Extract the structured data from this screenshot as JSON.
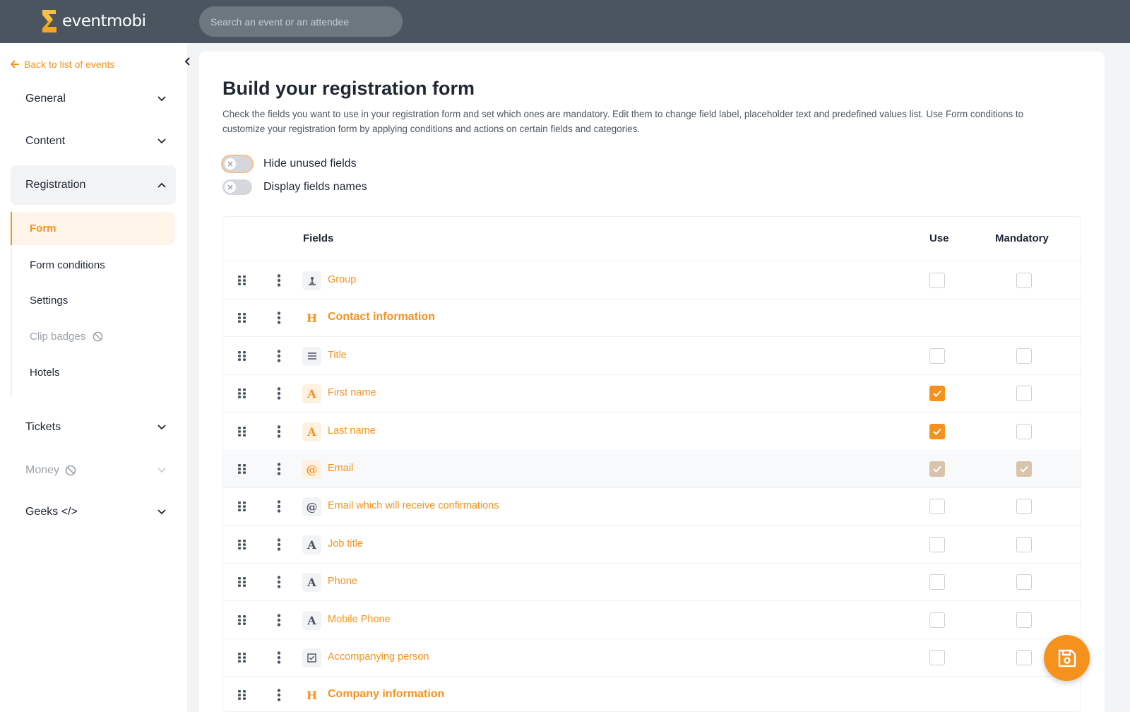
{
  "app": {
    "brand": "eventmobi",
    "brand_color": "#f5921e",
    "search_placeholder": "Search an event or an attendee"
  },
  "sidebar": {
    "back_label": "Back to list of events",
    "sections": [
      {
        "label": "General",
        "state": "collapsed"
      },
      {
        "label": "Content",
        "state": "collapsed"
      },
      {
        "label": "Registration",
        "state": "expanded"
      },
      {
        "label": "Tickets",
        "state": "collapsed"
      },
      {
        "label": "Money",
        "state": "disabled"
      },
      {
        "label": "Geeks </>",
        "state": "collapsed"
      }
    ],
    "registration_items": [
      {
        "label": "Form",
        "active": true
      },
      {
        "label": "Form conditions"
      },
      {
        "label": "Settings"
      },
      {
        "label": "Clip badges",
        "disabled": true
      },
      {
        "label": "Hotels"
      }
    ]
  },
  "main": {
    "title": "Build your registration form",
    "description_line1": "Check the fields you want to use in your registration form and set which ones are mandatory. Edit them to change field label, placeholder text and predefined values list. Use Form conditions to",
    "description_line2": "customize your registration form by applying conditions and actions on certain fields and categories.",
    "toggles": [
      {
        "label": "Hide unused fields",
        "on": false
      },
      {
        "label": "Display fields names",
        "on": false
      }
    ],
    "table": {
      "headers": {
        "fields": "Fields",
        "use": "Use",
        "mandatory": "Mandatory"
      },
      "rows": [
        {
          "icon": "group-icon",
          "label": "Group",
          "use": false,
          "mandatory": false
        },
        {
          "icon": "heading-icon",
          "label": "Contact information",
          "heading": true
        },
        {
          "icon": "list-icon",
          "label": "Title",
          "use": false,
          "mandatory": false
        },
        {
          "icon": "text-icon",
          "label": "First name",
          "use": true,
          "mandatory": false
        },
        {
          "icon": "text-icon",
          "label": "Last name",
          "use": true,
          "mandatory": false
        },
        {
          "icon": "at-icon",
          "label": "Email",
          "use": true,
          "mandatory": true,
          "locked": true
        },
        {
          "icon": "at-icon",
          "label": "Email which will receive confirmations",
          "use": false,
          "mandatory": false
        },
        {
          "icon": "text-icon",
          "label": "Job title",
          "use": false,
          "mandatory": false
        },
        {
          "icon": "text-icon",
          "label": "Phone",
          "use": false,
          "mandatory": false
        },
        {
          "icon": "text-icon",
          "label": "Mobile Phone",
          "use": false,
          "mandatory": false
        },
        {
          "icon": "checkbox-icon",
          "label": "Accompanying person",
          "use": false,
          "mandatory": false
        },
        {
          "icon": "heading-icon",
          "label": "Company information",
          "heading": true
        }
      ]
    }
  }
}
